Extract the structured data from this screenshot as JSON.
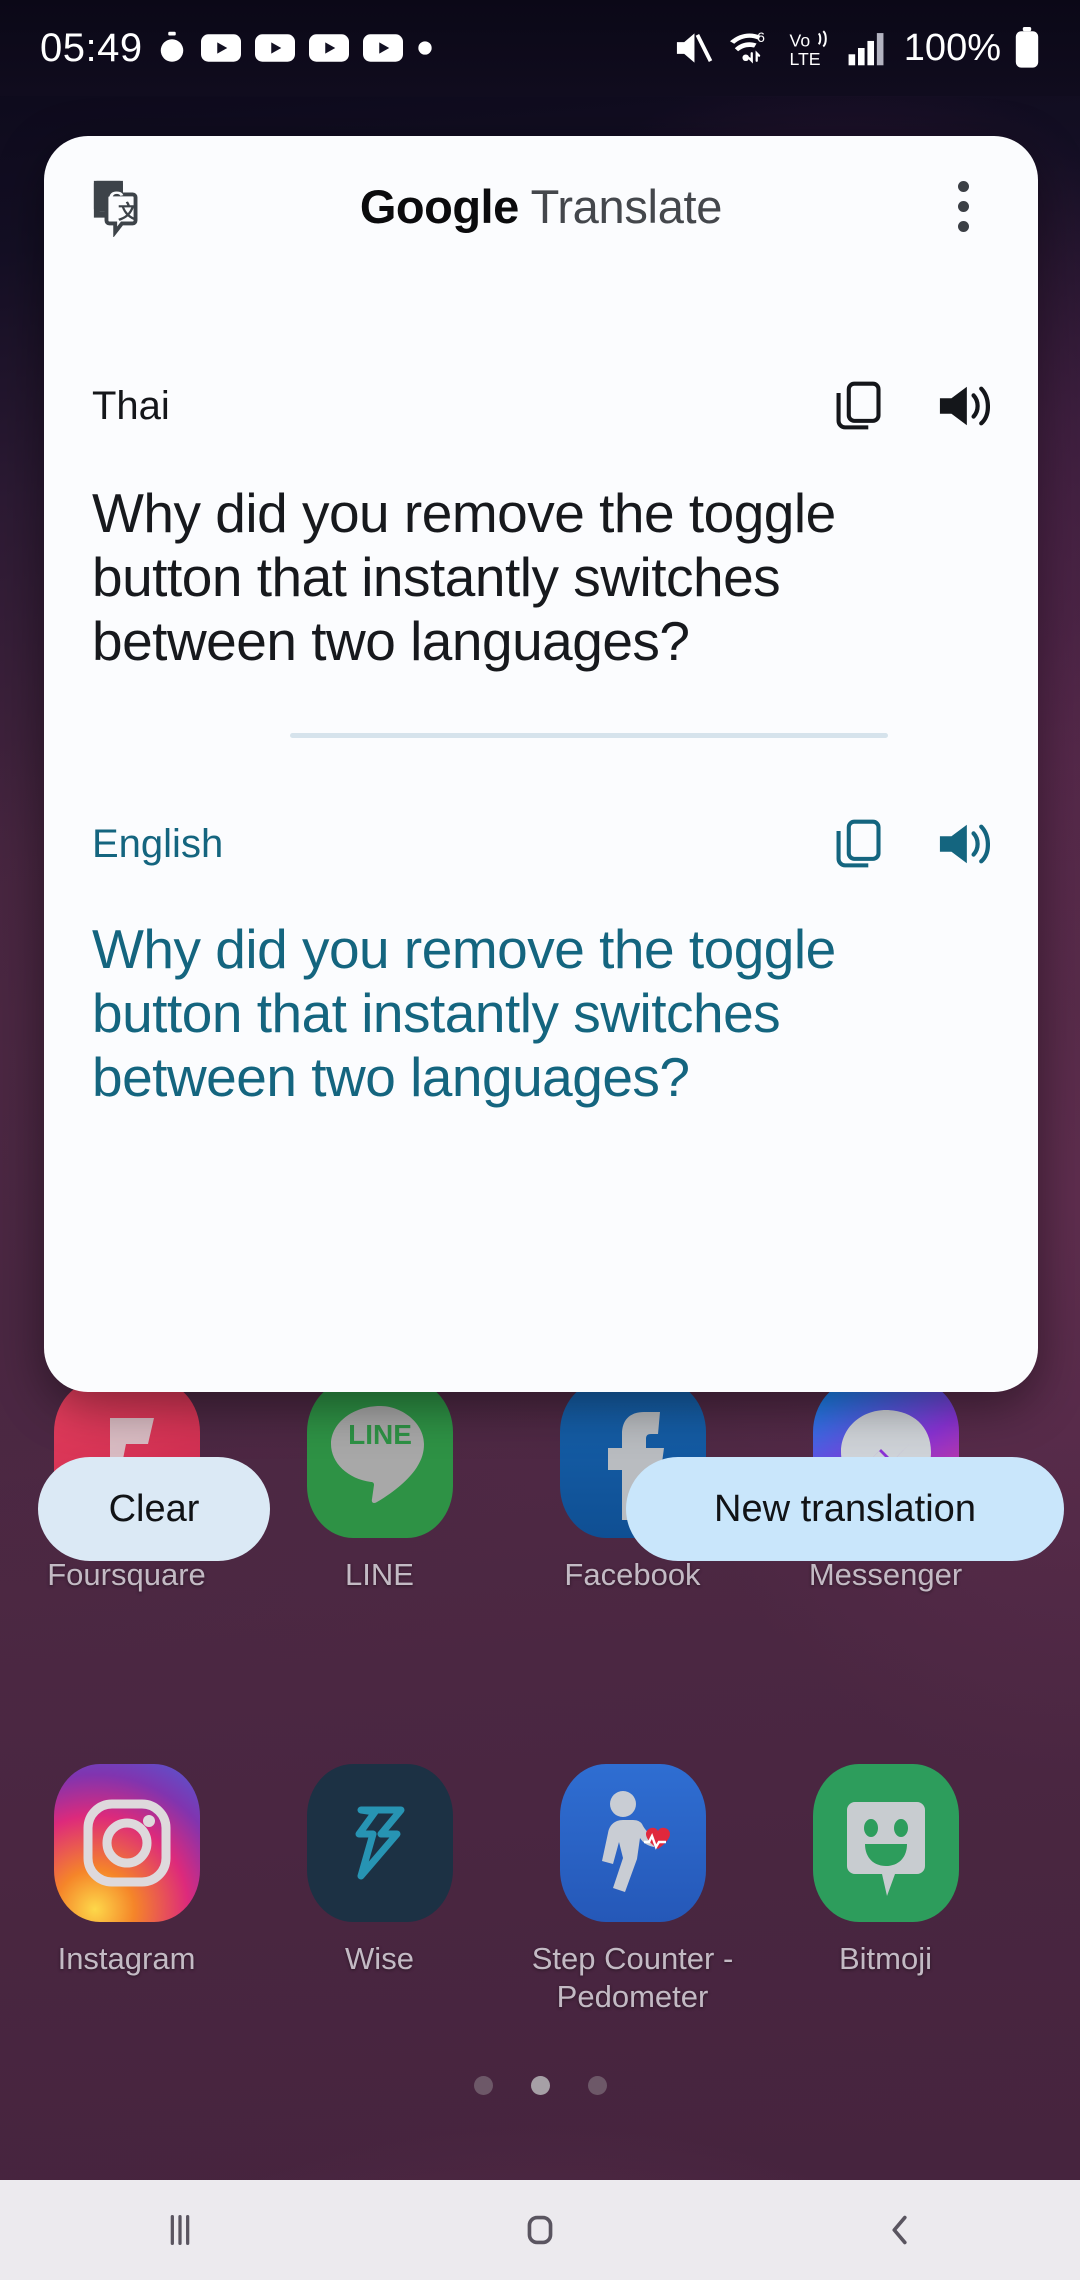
{
  "status_bar": {
    "time": "05:49",
    "battery_percent": "100%",
    "icons": [
      "stopwatch-icon",
      "youtube-icon",
      "youtube-icon",
      "youtube-icon",
      "youtube-icon",
      "dot-icon",
      "mute-icon",
      "wifi6-icon",
      "volte-icon",
      "signal-icon",
      "battery-icon"
    ]
  },
  "translate_card": {
    "app_title_bold": "Google",
    "app_title_light": " Translate",
    "logo": "google-translate-logo",
    "overflow_menu": "more-options",
    "source": {
      "language": "Thai",
      "text": "Why did you remove the toggle button that instantly switches between two languages?",
      "copy_action": "copy-icon",
      "speak_action": "volume-icon"
    },
    "target": {
      "language": "English",
      "text": "Why did you remove the toggle button that instantly switches between two languages?",
      "copy_action": "copy-icon",
      "speak_action": "volume-icon"
    },
    "accent_color": "#14657f"
  },
  "actions": {
    "clear_label": "Clear",
    "new_translation_label": "New translation"
  },
  "home_screen": {
    "rows": [
      [
        {
          "label": "Foursquare",
          "icon": "foursquare-icon"
        },
        {
          "label": "LINE",
          "icon": "line-icon"
        },
        {
          "label": "Facebook",
          "icon": "facebook-icon"
        },
        {
          "label": "Messenger",
          "icon": "messenger-icon"
        }
      ],
      [
        {
          "label": "Instagram",
          "icon": "instagram-icon"
        },
        {
          "label": "Wise",
          "icon": "wise-icon"
        },
        {
          "label": "Step Counter - Pedometer",
          "icon": "step-counter-icon"
        },
        {
          "label": "Bitmoji",
          "icon": "bitmoji-icon"
        }
      ]
    ],
    "page_dots": {
      "count": 3,
      "active_index": 1
    }
  },
  "nav_bar": {
    "recents": "recents-icon",
    "home": "home-icon",
    "back": "back-icon"
  }
}
